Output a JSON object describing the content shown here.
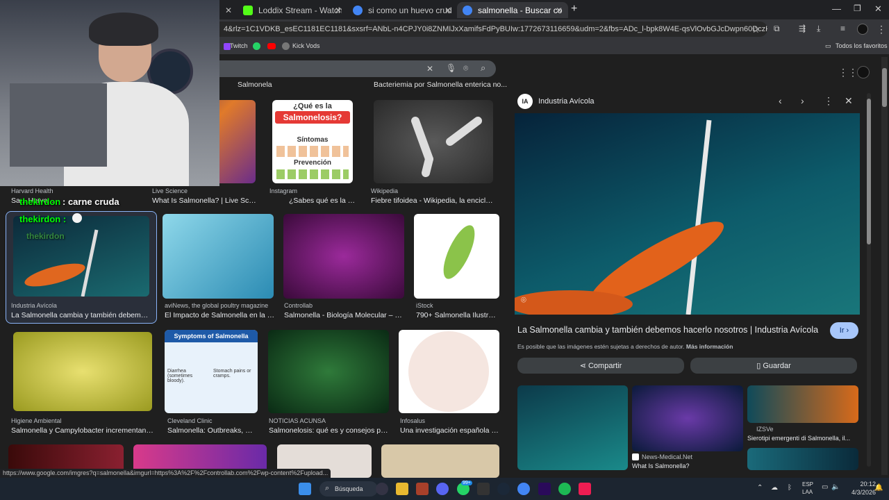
{
  "tabs": [
    {
      "title": "Loddix Stream - Watch Live on",
      "color": "#53fc18"
    },
    {
      "title": "si como un huevo crudo que pa",
      "color": "#4285f4"
    },
    {
      "title": "salmonella - Buscar con Google",
      "color": "#4285f4",
      "active": true
    }
  ],
  "new_tab_glyph": "+",
  "address_url": "4&rlz=1C1VDKB_esEC1181EC1181&sxsrf=ANbL-n4CPJY0i8ZNMIJxXamifsFdPyBUIw:1772673116659&udm=2&fbs=ADc_l-bpk8W4E-qsVlOvbGJcDwpn60DczFdcvPnuv8WQohHLTaf9f...",
  "bookmarks": {
    "items": [
      "Twitch",
      "Kick Vods"
    ],
    "right": "Todos los favoritos"
  },
  "chips": [
    "Salmonela",
    "Bacteriemia por Salmonella enterica no..."
  ],
  "stream_overlay": {
    "chat1_user": "thekirdon",
    "chat1_msg": ": carne cruda",
    "chat2_user": "thekirdon :",
    "chat3_user": "thekirdon"
  },
  "results_row1": [
    {
      "source": "Harvard Health",
      "caption": "Sa... Harva..."
    },
    {
      "source": "Live Science",
      "caption": "What Is Salmonella? | Live Scie..."
    },
    {
      "source": "Instagram",
      "caption": "¿Sabes qué es la sa..."
    },
    {
      "source": "Wikipedia",
      "caption": "Fiebre tifoidea - Wikipedia, la encicloped..."
    }
  ],
  "card_que_es": {
    "line1": "¿Qué es la",
    "line2": "Salmonelosis?",
    "sintomas": "Síntomas",
    "prevencion": "Prevención"
  },
  "results_row2": [
    {
      "source": "Industria Avícola",
      "caption": "La Salmonella cambia y también debemos h..."
    },
    {
      "source": "aviNews, the global poultry magazine",
      "caption": "El Impacto de Salmonella en la In..."
    },
    {
      "source": "Controllab",
      "caption": "Salmonella - Biología Molecular – Co..."
    },
    {
      "source": "iStock",
      "caption": "790+ Salmonella Ilustrac..."
    }
  ],
  "results_row3": [
    {
      "source": "Higiene Ambiental",
      "caption": "Salmonella y Campylobacter incrementan su r..."
    },
    {
      "source": "Cleveland Clinic",
      "caption": "Salmonella: Outbreaks, Ca..."
    },
    {
      "source": "NOTICIAS ACUNSA",
      "caption": "Salmonelosis: qué es y consejos para..."
    },
    {
      "source": "Infosalus",
      "caption": "Una investigación española so..."
    }
  ],
  "symptoms_card": {
    "title": "Symptoms of Salmonella",
    "diarrhea": "Diarrhea (sometimes bloody).",
    "stomach": "Stomach pains or cramps."
  },
  "panel": {
    "site": "Industria Avícola",
    "site_badge": "IA",
    "title": "La Salmonella cambia y también debemos hacerlo nosotros | Industria Avícola",
    "visit": "Ir",
    "copyright": "Es posible que las imágenes estén sujetas a derechos de autor.",
    "more_info": "Más información",
    "share": "Compartir",
    "save": "Guardar",
    "related": [
      {
        "source": "IZSVe",
        "caption": "Sierotipi emergenti di Salmonella, il..."
      },
      {
        "source": "News-Medical.Net",
        "caption": "What Is Salmonella?"
      }
    ]
  },
  "status_url": "https://www.google.com/imgres?q=salmonella&imgurl=https%3A%2F%2Fcontrollab.com%2Fwp-content%2Fupload...",
  "taskbar": {
    "search": "Búsqueda",
    "lang": "ESP",
    "region": "LAA",
    "time": "20:12",
    "date": "4/3/2026",
    "badge": "99+"
  }
}
